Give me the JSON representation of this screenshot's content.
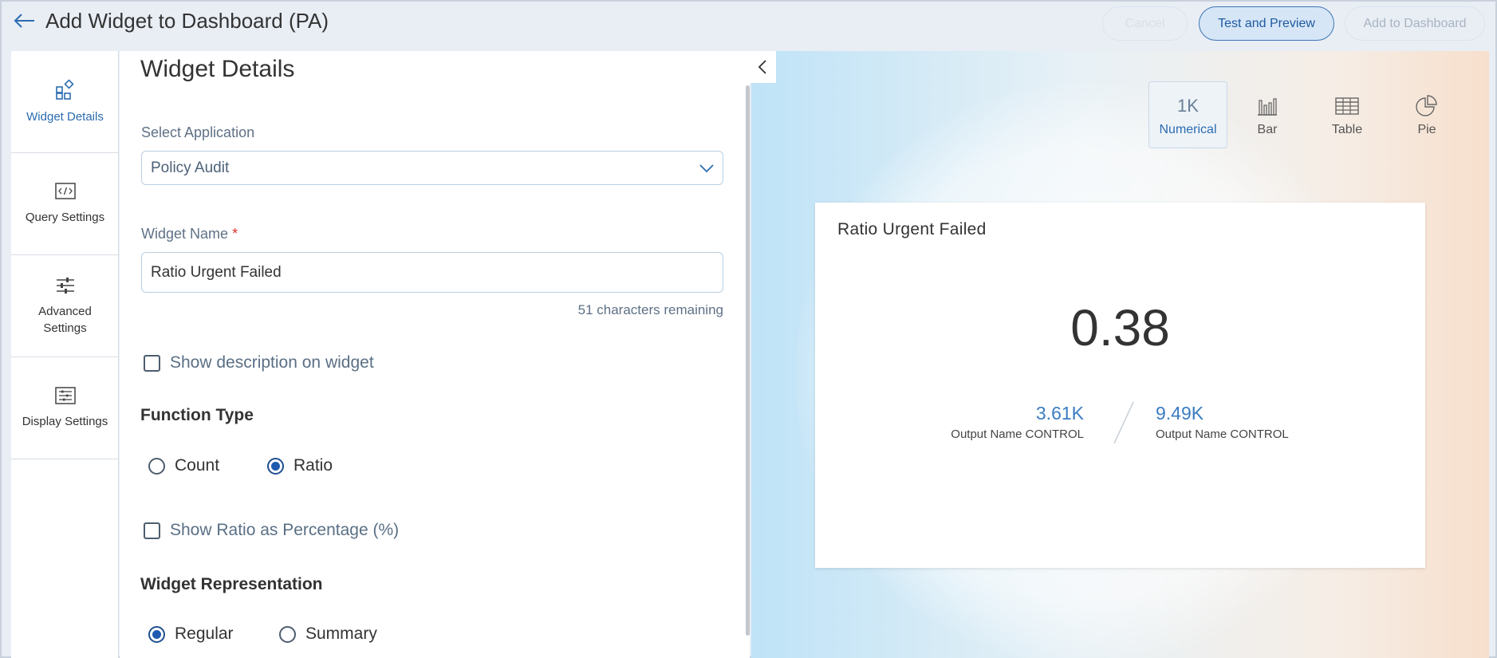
{
  "header": {
    "title": "Add Widget to Dashboard (PA)",
    "cancel_label": "Cancel",
    "test_label": "Test and Preview",
    "add_label": "Add to Dashboard"
  },
  "nav": {
    "items": [
      {
        "label": "Widget Details",
        "icon": "widget-details-icon",
        "active": true
      },
      {
        "label": "Query Settings",
        "icon": "code-icon",
        "active": false
      },
      {
        "label": "Advanced Settings",
        "icon": "sliders-icon",
        "active": false
      },
      {
        "label": "Display Settings",
        "icon": "display-settings-icon",
        "active": false
      }
    ]
  },
  "form": {
    "section_title": "Widget Details",
    "select_application_label": "Select Application",
    "select_application_value": "Policy Audit",
    "widget_name_label": "Widget Name",
    "required_mark": "*",
    "widget_name_value": "Ratio Urgent Failed",
    "remaining_text": "51 characters remaining",
    "show_description_label": "Show description on widget",
    "show_description_checked": false,
    "function_type_title": "Function Type",
    "function_options": [
      {
        "label": "Count",
        "checked": false
      },
      {
        "label": "Ratio",
        "checked": true
      }
    ],
    "show_ratio_pct_label": "Show Ratio as Percentage (%)",
    "show_ratio_pct_checked": false,
    "representation_title": "Widget Representation",
    "representation_options": [
      {
        "label": "Regular",
        "checked": true
      },
      {
        "label": "Summary",
        "checked": false
      }
    ]
  },
  "preview": {
    "chart_types": [
      {
        "label": "Numerical",
        "icon_text": "1K",
        "active": true
      },
      {
        "label": "Bar",
        "icon": "bar-chart-icon",
        "active": false
      },
      {
        "label": "Table",
        "icon": "table-icon",
        "active": false
      },
      {
        "label": "Pie",
        "icon": "pie-chart-icon",
        "active": false
      }
    ],
    "card": {
      "title": "Ratio Urgent Failed",
      "value": "0.38",
      "numerator_value": "3.61K",
      "numerator_label": "Output Name CONTROL",
      "denominator_value": "9.49K",
      "denominator_label": "Output Name CONTROL"
    }
  },
  "colors": {
    "accent": "#2b6cb0",
    "radio_selected": "#1e5bb0",
    "required": "#d9342b"
  }
}
